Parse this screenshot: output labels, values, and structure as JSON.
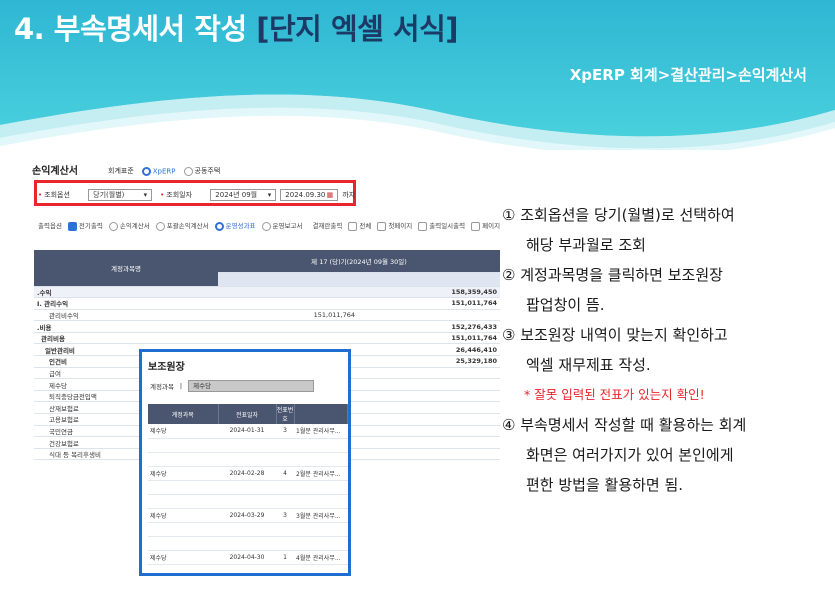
{
  "slide": {
    "title_prefix": "4. 부속명세서 작성 ",
    "title_highlight": "[단지 엑셀 서식]",
    "path": "XpERP 회계>결산관리>손익계산서"
  },
  "app": {
    "title": "손익계산서",
    "tab_label": "회계표준",
    "tab_opt1": "XpERP",
    "tab_opt2": "공동주택",
    "query_option_label": "조회옵션",
    "query_option_value": "당기(월별)",
    "query_date_label": "조회일자",
    "date_month": "2024년 09월",
    "date_to": "2024.09.30",
    "date_suffix": "까지",
    "print_option_label": "출력옵션",
    "opt_prior": "전기출력",
    "opt_income": "손익계산서",
    "opt_include": "포괄손익계산서",
    "opt_running": "운영성과표",
    "opt_report": "운영보고서",
    "settle_label": "결재란출력",
    "settle_all": "전체",
    "settle_first": "첫페이지",
    "settle_date": "출력일시출력",
    "settle_page": "페이지번호출력",
    "col_account": "계정과목명",
    "col_period": "제 17 (당)기(2024년 09월 30일)",
    "rows": [
      {
        "name": ".수익",
        "mid": "",
        "val": "158,359,450",
        "bold": true
      },
      {
        "name": "I. 관리수익",
        "mid": "",
        "val": "151,011,764",
        "bold": true
      },
      {
        "name": "관리비수익",
        "mid": "151,011,764",
        "val": "",
        "bold": false
      },
      {
        "name": ".비용",
        "mid": "",
        "val": "152,276,433",
        "bold": true
      },
      {
        "name": "관리비용",
        "mid": "",
        "val": "151,011,764",
        "bold": true
      },
      {
        "name": "일반관리비",
        "mid": "",
        "val": "26,446,410",
        "bold": true
      },
      {
        "name": "인건비",
        "mid": "",
        "val": "25,329,180",
        "bold": true
      },
      {
        "name": "급여",
        "mid": "",
        "val": "",
        "bold": false
      },
      {
        "name": "제수당",
        "mid": "",
        "val": "",
        "bold": false
      },
      {
        "name": "퇴직충당금전입액",
        "mid": "",
        "val": "",
        "bold": false
      },
      {
        "name": "산재보험료",
        "mid": "",
        "val": "",
        "bold": false
      },
      {
        "name": "고용보험료",
        "mid": "",
        "val": "",
        "bold": false
      },
      {
        "name": "국민연금",
        "mid": "",
        "val": "",
        "bold": false
      },
      {
        "name": "건강보험료",
        "mid": "",
        "val": "",
        "bold": false
      },
      {
        "name": "식대 등 복리후생비",
        "mid": "",
        "val": "",
        "bold": false
      }
    ]
  },
  "popup": {
    "title": "보조원장",
    "filter_label": "계정과목",
    "filter_value": "제수당",
    "col_account": "계정과목",
    "col_date": "전표일자",
    "col_no": "전표번호",
    "entries": [
      {
        "account": "제수당",
        "date": "2024-01-31",
        "no": "3",
        "memo": "1월분 관리사무..."
      },
      {
        "account": "제수당",
        "date": "2024-02-28",
        "no": "4",
        "memo": "2월분 관리사무..."
      },
      {
        "account": "제수당",
        "date": "2024-03-29",
        "no": "3",
        "memo": "3월분 관리사무..."
      },
      {
        "account": "제수당",
        "date": "2024-04-30",
        "no": "1",
        "memo": "4월분 관리사무..."
      }
    ]
  },
  "notes": {
    "n1a": "① 조회옵션을 당기(월별)로 선택하여",
    "n1b": "해당 부과월로 조회",
    "n2a": "② 계정과목명을 클릭하면 보조원장",
    "n2b": "팝업창이 뜸.",
    "n3a": "③ 보조원장 내역이 맞는지 확인하고",
    "n3b": "엑셀 재무제표 작성.",
    "warn": "* 잘못 입력된 전표가 있는지 확인!",
    "n4a": "④ 부속명세서 작성할 때 활용하는 회계",
    "n4b": "화면은 여러가지가 있어 본인에게",
    "n4c": "편한 방법을 활용하면 됨."
  },
  "colors": {
    "banner_light": "#3cc8d8",
    "banner_dark": "#1a8fb3",
    "title_highlight": "#1b3a66",
    "red_box": "#e8262b",
    "popup_border": "#1f6fd0"
  }
}
